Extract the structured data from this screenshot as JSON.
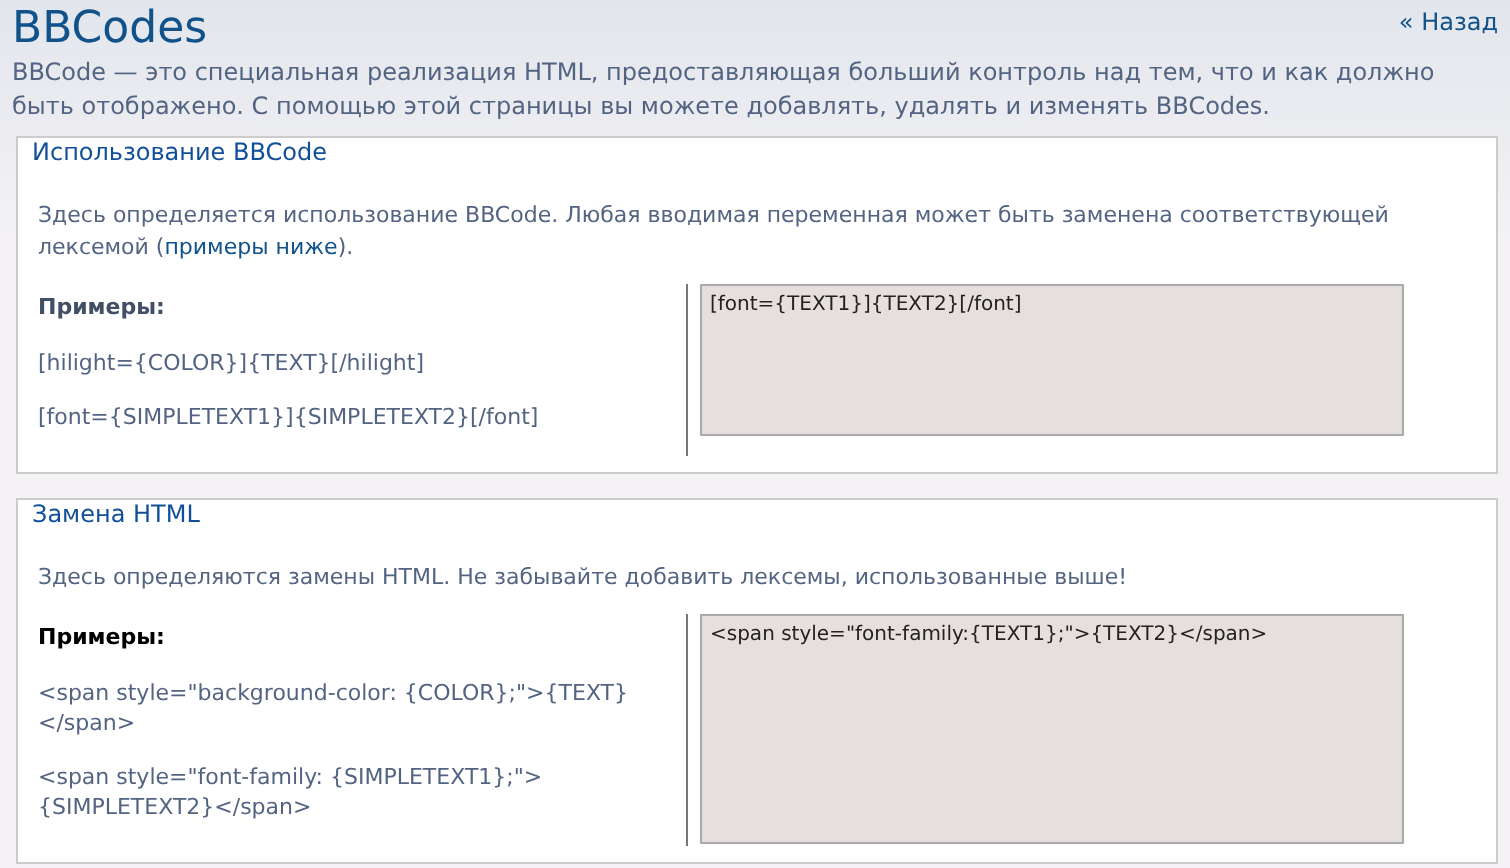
{
  "page": {
    "title": "BBCodes",
    "back_link": "« Назад",
    "intro": "BBCode — это специальная реализация HTML, предоставляющая больший контроль над тем, что и как должно быть отображено. С помощью этой страницы вы можете добавлять, удалять и изменять BBCodes."
  },
  "sections": [
    {
      "legend": "Использование BBCode",
      "description": "Здесь определяется использование BBCode. Любая вводимая переменная может быть заменена соответствующей лексемой (",
      "description_link": "примеры ниже",
      "description_after": ").",
      "examples_heading": "Примеры:",
      "examples": [
        "[hilight={COLOR}]{TEXT}[/hilight]",
        "[font={SIMPLETEXT1}]{SIMPLETEXT2}[/font]"
      ],
      "field_value": "[font={TEXT1}]{TEXT2}[/font]"
    },
    {
      "legend": "Замена HTML",
      "description": "Здесь определяются замены HTML. Не забывайте добавить лексемы, использованные выше!",
      "examples_heading": "Примеры:",
      "examples": [
        "<span style=\"background-color: {COLOR};\">{TEXT}</span>",
        "<span style=\"font-family: {SIMPLETEXT1};\">{SIMPLETEXT2}</span>"
      ],
      "field_value": "<span style=\"font-family:{TEXT1};\">{TEXT2}</span>"
    }
  ]
}
